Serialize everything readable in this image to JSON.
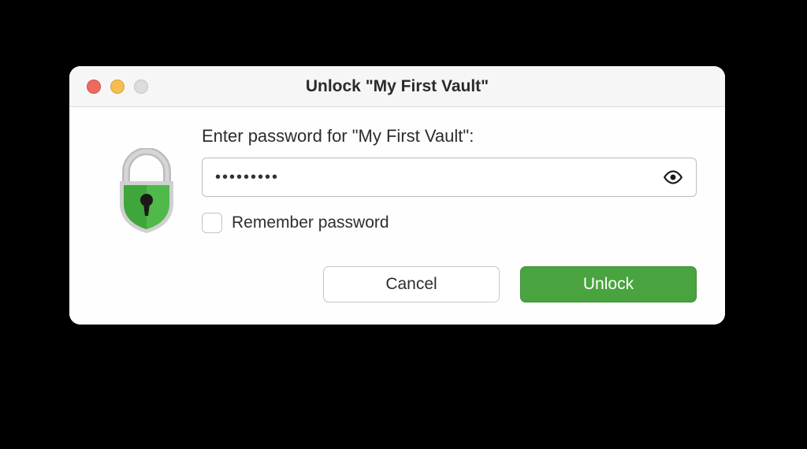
{
  "window": {
    "title": "Unlock \"My First Vault\""
  },
  "form": {
    "prompt": "Enter password for \"My First Vault\":",
    "password_value": "•••••••••",
    "remember_label": "Remember password",
    "remember_checked": false
  },
  "buttons": {
    "cancel": "Cancel",
    "unlock": "Unlock"
  },
  "icons": {
    "lock": "lock-icon",
    "eye": "eye-icon"
  },
  "colors": {
    "accent_green": "#49a43f",
    "lock_green": "#3fa63c",
    "traffic_close": "#ec6a5e",
    "traffic_min": "#f4bf4f",
    "traffic_disabled": "#dcdcdc"
  }
}
